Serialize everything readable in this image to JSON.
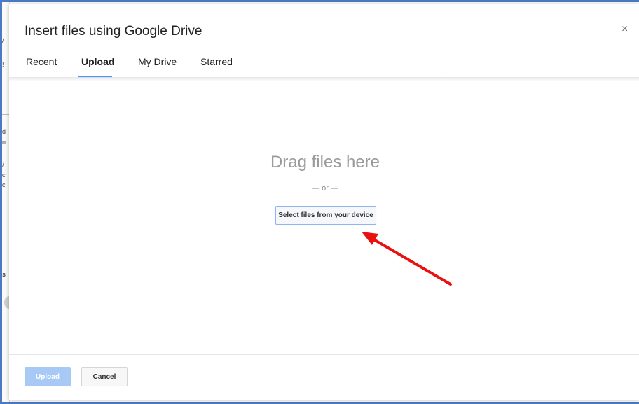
{
  "dialog": {
    "title": "Insert files using Google Drive",
    "close_glyph": "×"
  },
  "tabs": [
    {
      "label": "Recent",
      "active": false
    },
    {
      "label": "Upload",
      "active": true
    },
    {
      "label": "My Drive",
      "active": false
    },
    {
      "label": "Starred",
      "active": false
    }
  ],
  "upload_area": {
    "drop_text": "Drag files here",
    "or_text": "— or —",
    "select_button_label": "Select files from your device"
  },
  "footer": {
    "upload_label": "Upload",
    "upload_enabled": false,
    "cancel_label": "Cancel"
  },
  "colors": {
    "accent": "#4d90fe",
    "upload_disabled": "#a8c8f5",
    "annotation_arrow": "#e8110f",
    "frame": "#4a7bc4"
  },
  "annotation": {
    "icon": "red-arrow-icon",
    "points_to": "select-files-button"
  },
  "background_fragments": [
    "d",
    "n",
    "/",
    "c",
    "c",
    "s"
  ]
}
